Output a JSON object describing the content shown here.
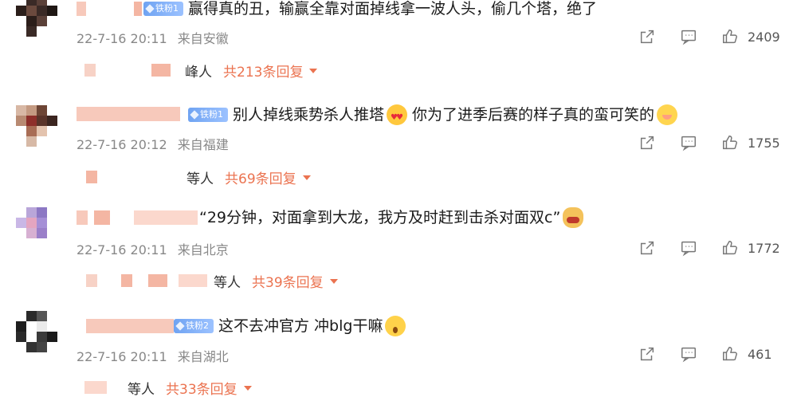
{
  "comments": [
    {
      "badge": "铁粉1",
      "text": "赢得真的丑，输赢全靠对面掉线拿一波人头，偷几个塔，绝了",
      "emoji": "",
      "time": "22-7-16 20:11",
      "location": "来自安徽",
      "likes": "2409",
      "reply_who": "峰人",
      "reply_more": "共213条回复"
    },
    {
      "badge": "铁粉1",
      "text": "别人掉线乘势杀人推塔",
      "text2": "你为了进季后赛的样子真的蛮可笑的",
      "emoji": "heart-eyes",
      "emoji2": "blush",
      "time": "22-7-16 20:12",
      "location": "来自福建",
      "likes": "1755",
      "reply_who": "等人",
      "reply_more": "共69条回复"
    },
    {
      "badge": "",
      "text": "“29分钟，对面拿到大龙，我方及时赶到击杀对面双c”",
      "emoji": "rage",
      "time": "22-7-16 20:11",
      "location": "来自北京",
      "likes": "1772",
      "reply_who": "等人",
      "reply_more": "共39条回复"
    },
    {
      "badge": "铁粉2",
      "text": "这不去冲官方 冲blg干嘛",
      "emoji": "shock",
      "time": "22-7-16 20:11",
      "location": "来自湖北",
      "likes": "461",
      "reply_who": "等人",
      "reply_more": "共33条回复"
    }
  ],
  "icons": {
    "share": "share-icon",
    "comment": "comment-icon",
    "like": "like-icon",
    "caret": "chevron-down-icon"
  },
  "colors": {
    "accent": "#eb7350",
    "meta": "#888888",
    "badge": "#6fa3f2"
  }
}
